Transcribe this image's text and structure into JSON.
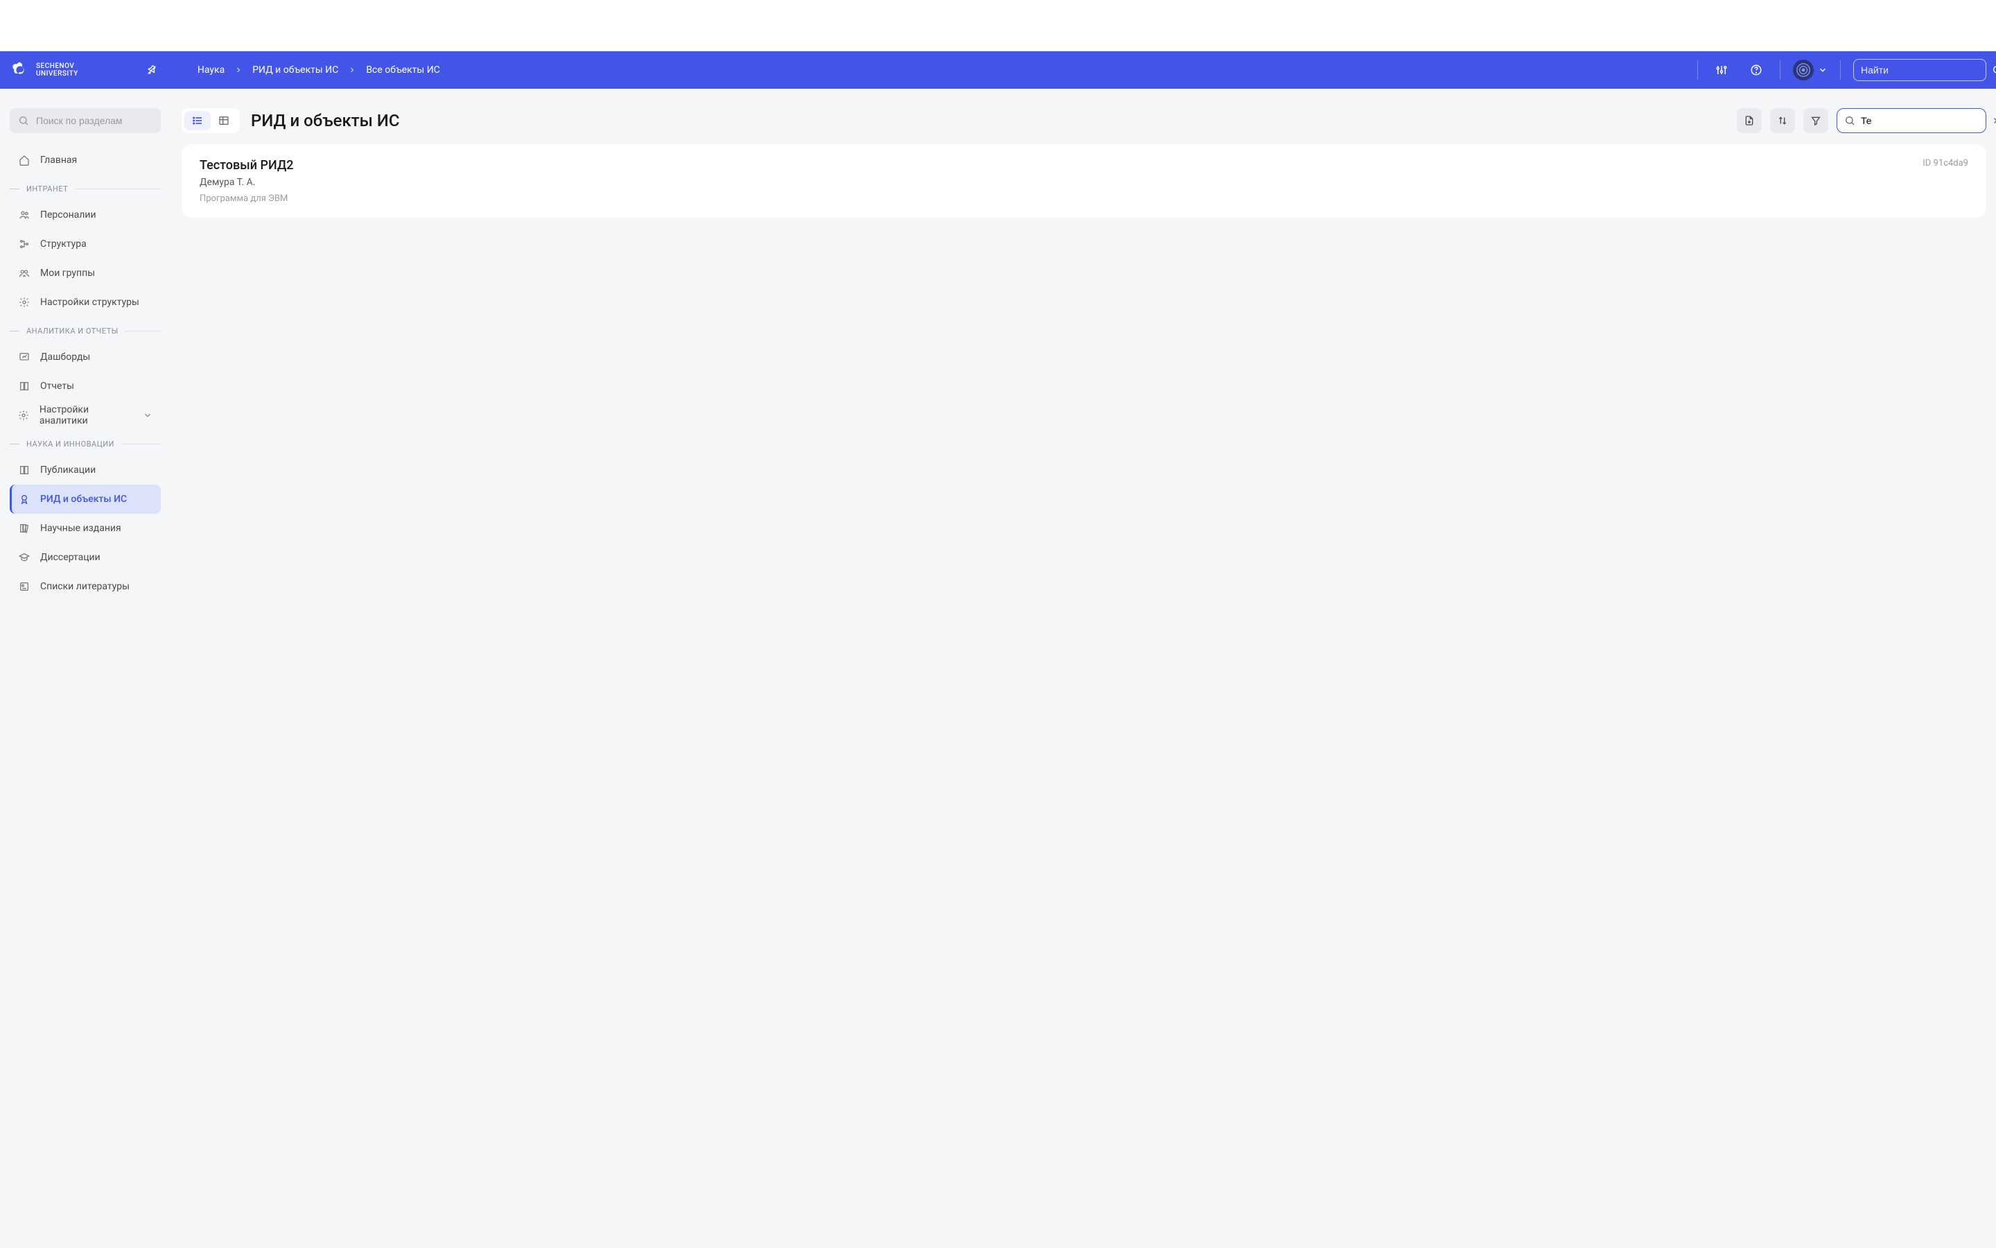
{
  "logo": {
    "line1": "SECHENOV",
    "line2": "UNIVERSITY"
  },
  "breadcrumbs": [
    "Наука",
    "РИД и объекты ИС",
    "Все объекты ИС"
  ],
  "header_search": {
    "placeholder": "Найти",
    "value": ""
  },
  "sidebar": {
    "search_placeholder": "Поиск по разделам",
    "top_item": "Главная",
    "sections": [
      {
        "label": "ИНТРАНЕТ",
        "items": [
          {
            "icon": "users",
            "label": "Персоналии"
          },
          {
            "icon": "org",
            "label": "Структура"
          },
          {
            "icon": "group",
            "label": "Мои группы"
          },
          {
            "icon": "gear",
            "label": "Настройки структуры"
          }
        ]
      },
      {
        "label": "АНАЛИТИКА И ОТЧЕТЫ",
        "items": [
          {
            "icon": "dashboard",
            "label": "Дашборды"
          },
          {
            "icon": "book",
            "label": "Отчеты"
          },
          {
            "icon": "gear",
            "label": "Настройки аналитики",
            "expandable": true
          }
        ]
      },
      {
        "label": "НАУКА И ИННОВАЦИИ",
        "items": [
          {
            "icon": "book",
            "label": "Публикации"
          },
          {
            "icon": "award",
            "label": "РИД и объекты ИС",
            "active": true
          },
          {
            "icon": "books",
            "label": "Научные издания"
          },
          {
            "icon": "cap",
            "label": "Диссертации"
          },
          {
            "icon": "list",
            "label": "Списки литературы"
          }
        ]
      }
    ]
  },
  "main": {
    "title": "РИД и объекты ИС",
    "search_value": "Те",
    "results": [
      {
        "title": "Тестовый РИД2",
        "id": "ID 91c4da9",
        "author": "Демура Т. А.",
        "type": "Программа для ЭВМ"
      }
    ]
  }
}
